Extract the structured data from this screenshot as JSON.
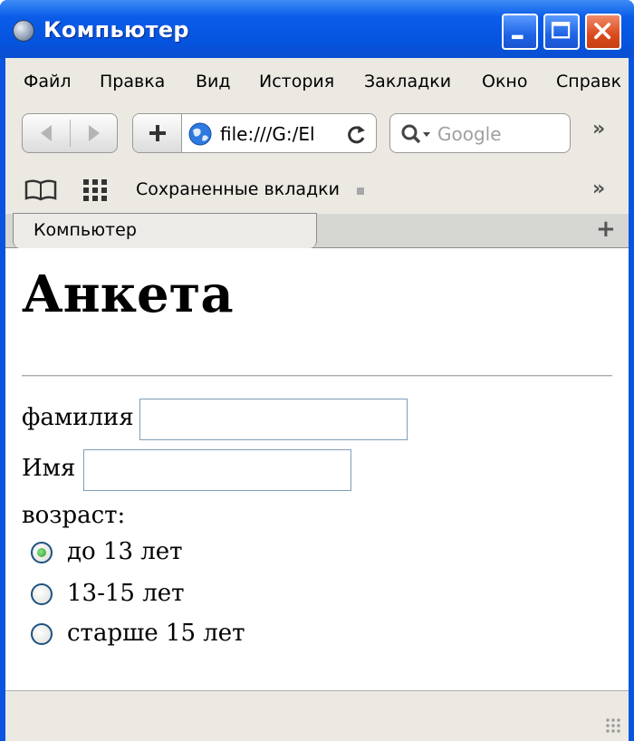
{
  "window": {
    "title": "Компьютер"
  },
  "menu": {
    "items": [
      "Файл",
      "Правка",
      "Вид",
      "История",
      "Закладки",
      "Окно",
      "Справк"
    ]
  },
  "toolbar": {
    "url": "file:///G:/El",
    "search_placeholder": "Google"
  },
  "bookmarks": {
    "label": "Сохраненные вкладки"
  },
  "tabs": [
    {
      "label": "Компьютер",
      "active": true
    }
  ],
  "page": {
    "heading": "Анкета",
    "fields": {
      "surname_label": "фамилия",
      "surname_value": "",
      "name_label": "Имя",
      "name_value": ""
    },
    "age": {
      "label": "возраст:",
      "options": [
        {
          "label": "до 13 лет",
          "checked": true
        },
        {
          "label": "13-15 лет",
          "checked": false
        },
        {
          "label": "старше 15 лет",
          "checked": false
        }
      ]
    }
  },
  "colors": {
    "titlebar": "#0a55e0",
    "radio_checked": "#21a121"
  }
}
